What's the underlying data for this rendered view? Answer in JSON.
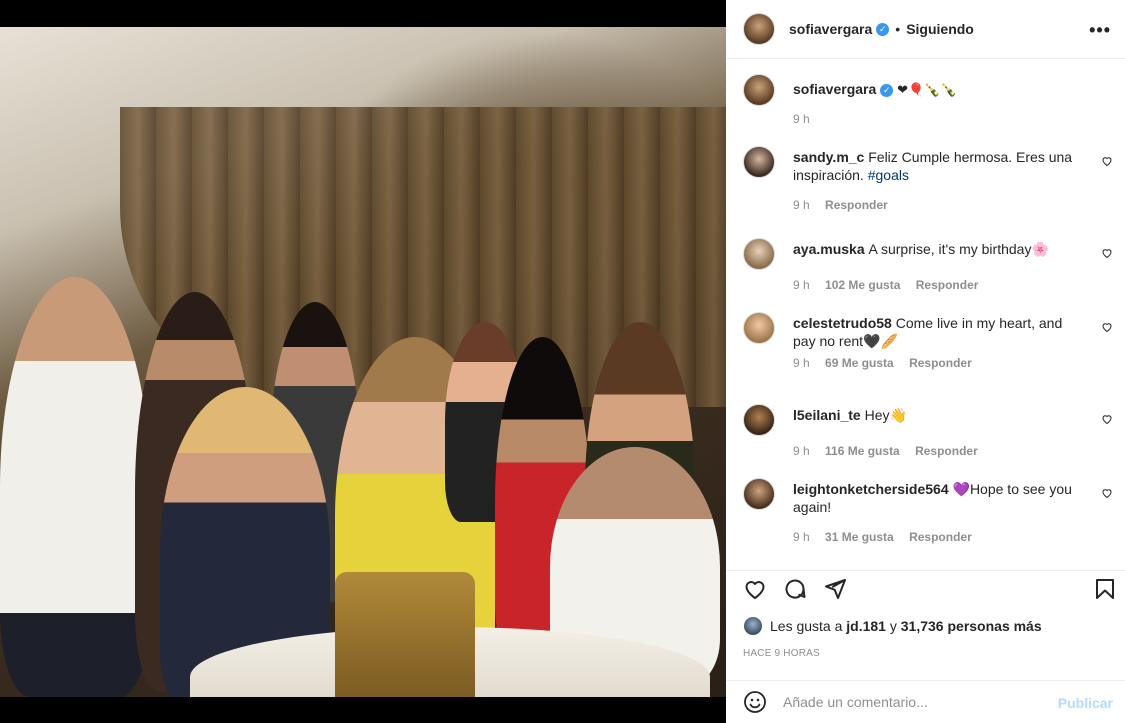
{
  "header": {
    "username": "sofiavergara",
    "separator": "•",
    "following_label": "Siguiendo",
    "more_label": "•••"
  },
  "caption": {
    "username": "sofiavergara",
    "text": "❤🎈🍾🍾",
    "time": "9 h"
  },
  "comments": [
    {
      "username": "sandy.m_c",
      "text": "Feliz Cumple hermosa. Eres una inspiración.",
      "hashtag": "#goals",
      "time": "9 h",
      "likes": "",
      "reply": "Responder"
    },
    {
      "username": "aya.muska",
      "text": "A surprise, it's my birthday🌸",
      "hashtag": "",
      "time": "9 h",
      "likes": "102 Me gusta",
      "reply": "Responder"
    },
    {
      "username": "celestetrudo58",
      "text": "Come live in my heart, and pay no rent🖤🥖",
      "hashtag": "",
      "time": "9 h",
      "likes": "69 Me gusta",
      "reply": "Responder"
    },
    {
      "username": "l5eilani_te",
      "text": "Hey👋",
      "hashtag": "",
      "time": "9 h",
      "likes": "116 Me gusta",
      "reply": "Responder"
    },
    {
      "username": "leightonketcherside564",
      "text": "💜Hope to see you again!",
      "hashtag": "",
      "time": "9 h",
      "likes": "31 Me gusta",
      "reply": "Responder"
    }
  ],
  "likes": {
    "prefix": "Les gusta a",
    "user": "jd.181",
    "middle": "y",
    "count": "31,736 personas más"
  },
  "time_ago": "HACE 9 HORAS",
  "add_comment": {
    "placeholder": "Añade un comentario...",
    "publish_label": "Publicar"
  },
  "colors": {
    "verified": "#3897f0",
    "link": "#00376b",
    "muted": "#8e8e8e",
    "publish_disabled": "#b3dbff"
  },
  "icons": [
    "verified-icon",
    "more-icon",
    "heart-icon",
    "comment-icon",
    "share-icon",
    "bookmark-icon",
    "emoji-icon"
  ]
}
